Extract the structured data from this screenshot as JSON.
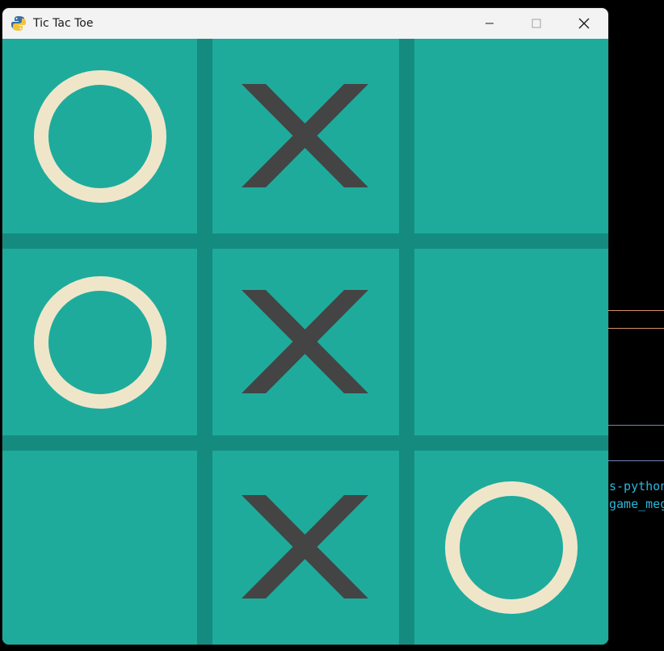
{
  "window": {
    "title": "Tic Tac Toe",
    "icon": "python-snake-icon"
  },
  "controls": {
    "minimize": "minimize-icon",
    "maximize": "maximize-icon",
    "close": "close-icon"
  },
  "board": {
    "cells": [
      [
        "O",
        "X",
        ""
      ],
      [
        "O",
        "X",
        ""
      ],
      [
        "",
        "X",
        "O"
      ]
    ]
  },
  "colors": {
    "board_background": "#1eab9c",
    "grid_lines": "#158b80",
    "x_mark": "#444444",
    "o_mark": "#efe6ca"
  },
  "background_terminal": {
    "line1": "s-python",
    "line2": "game_meg"
  }
}
